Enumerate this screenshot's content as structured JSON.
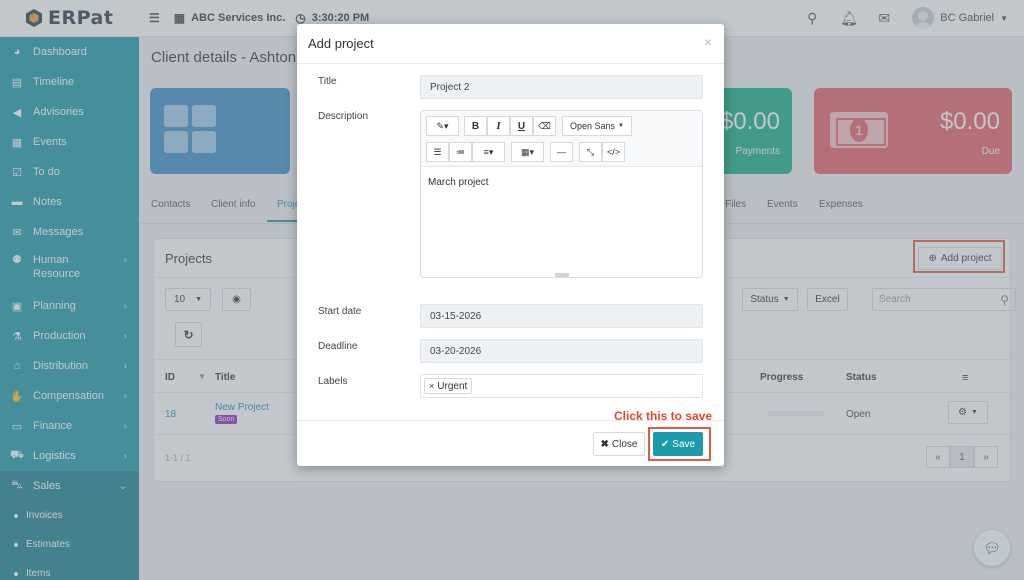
{
  "app": {
    "logo_text": "ERPat"
  },
  "topbar": {
    "company": "ABC Services Inc.",
    "time": "3:30:20 PM",
    "user_name": "BC Gabriel"
  },
  "sidebar": {
    "items": [
      {
        "label": "Dashboard",
        "icon": "palette-icon"
      },
      {
        "label": "Timeline",
        "icon": "timeline-icon"
      },
      {
        "label": "Advisories",
        "icon": "megaphone-icon"
      },
      {
        "label": "Events",
        "icon": "calendar-icon"
      },
      {
        "label": "To do",
        "icon": "check-square-icon"
      },
      {
        "label": "Notes",
        "icon": "note-icon"
      },
      {
        "label": "Messages",
        "icon": "envelope-icon"
      },
      {
        "label": "Human Resource",
        "icon": "people-icon"
      },
      {
        "label": "Planning",
        "icon": "briefcase-icon"
      },
      {
        "label": "Production",
        "icon": "flask-icon"
      },
      {
        "label": "Distribution",
        "icon": "bank-icon"
      },
      {
        "label": "Compensation",
        "icon": "handshake-icon"
      },
      {
        "label": "Finance",
        "icon": "money-icon"
      },
      {
        "label": "Logistics",
        "icon": "truck-icon"
      },
      {
        "label": "Sales",
        "icon": "cart-icon"
      }
    ],
    "sales_subitems": [
      "Invoices",
      "Estimates",
      "Items"
    ]
  },
  "page": {
    "title": "Client details - Ashton",
    "cards": {
      "payments_amount": "$0.00",
      "payments_label": "Payments",
      "due_amount": "$0.00",
      "due_label": "Due"
    },
    "tabs": [
      "Contacts",
      "Client info",
      "Proje",
      "Files",
      "Events",
      "Expenses"
    ]
  },
  "projects_panel": {
    "title": "Projects",
    "add_button": "Add project",
    "page_size": "10",
    "status_filter": "Status",
    "excel_button": "Excel",
    "search_placeholder": "Search",
    "columns": {
      "id": "ID",
      "title": "Title",
      "progress": "Progress",
      "status": "Status"
    },
    "rows": [
      {
        "id": "18",
        "title": "New Project",
        "badge": "Soon",
        "status": "Open"
      }
    ],
    "range_text": "1-1 / 1",
    "pager": [
      "«",
      "1",
      "»"
    ]
  },
  "modal": {
    "title": "Add project",
    "close_x": "×",
    "fields": {
      "title_label": "Title",
      "title_value": "Project 2",
      "description_label": "Description",
      "description_value": "March project",
      "font_name": "Open Sans",
      "start_date_label": "Start date",
      "start_date_value": "03-15-2026",
      "deadline_label": "Deadline",
      "deadline_value": "03-20-2026",
      "labels_label": "Labels",
      "label_tag": "Urgent"
    },
    "buttons": {
      "close": "Close",
      "save": "Save"
    },
    "annotation": "Click this to save"
  },
  "colors": {
    "sidebar": "#1d9aab",
    "primary": "#1d9aab",
    "highlight": "#e25a3c",
    "annotation": "#e2472f",
    "card_blue": "#3b8fc6",
    "card_green": "#16ad8a",
    "card_red": "#e66067"
  }
}
